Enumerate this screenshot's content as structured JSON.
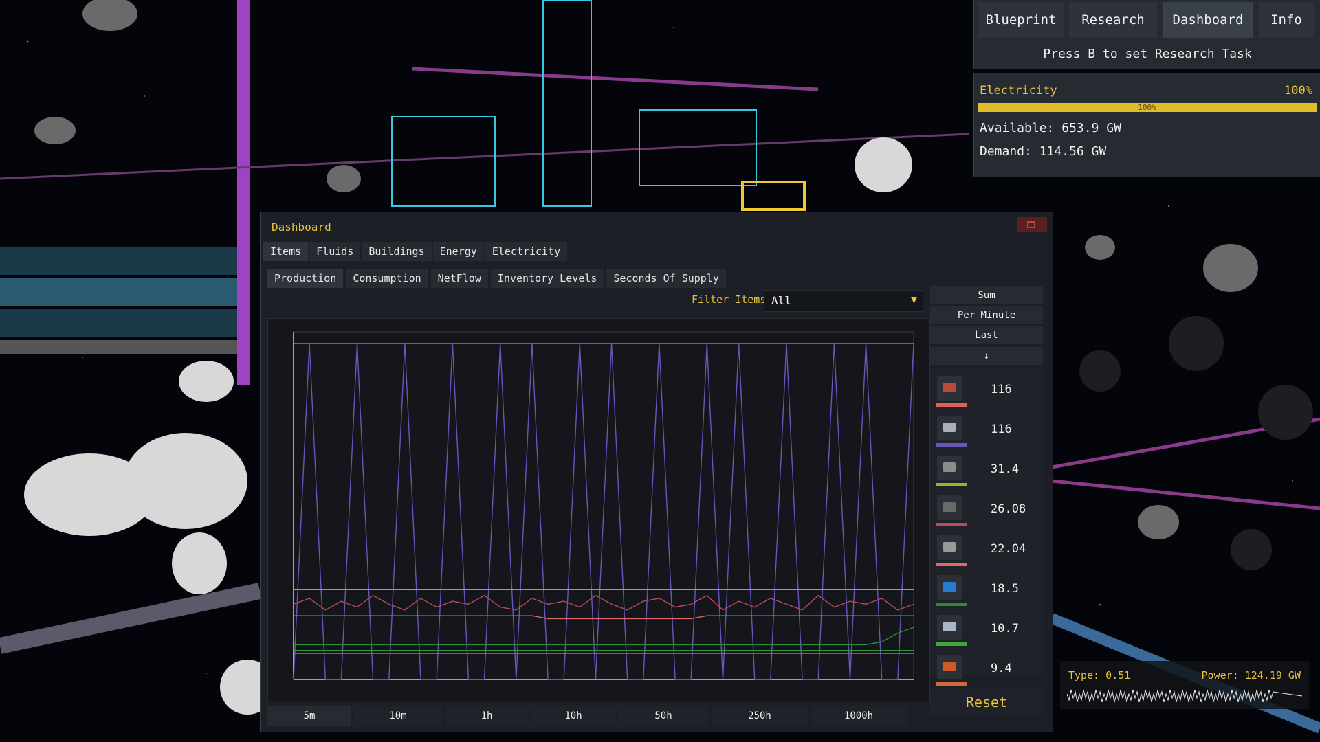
{
  "top_nav": {
    "tabs": [
      {
        "label": "Blueprint"
      },
      {
        "label": "Research"
      },
      {
        "label": "Dashboard",
        "active": true
      },
      {
        "label": "Info"
      }
    ],
    "hint": "Press B to set Research Task"
  },
  "electricity": {
    "title": "Electricity",
    "percent": "100%",
    "bar_fraction": 1.0,
    "bar_text": "100%",
    "available": "Available: 653.9 GW",
    "demand": "Demand: 114.56 GW"
  },
  "dashboard": {
    "title": "Dashboard",
    "main_tabs": [
      {
        "label": "Items",
        "active": true
      },
      {
        "label": "Fluids"
      },
      {
        "label": "Buildings"
      },
      {
        "label": "Energy"
      },
      {
        "label": "Electricity"
      }
    ],
    "sub_tabs": [
      {
        "label": "Production",
        "active": true
      },
      {
        "label": "Consumption"
      },
      {
        "label": "NetFlow"
      },
      {
        "label": "Inventory Levels"
      },
      {
        "label": "Seconds Of Supply"
      }
    ],
    "filter": {
      "label": "Filter Items",
      "value": "All"
    },
    "side_buttons": {
      "sum": "Sum",
      "per_minute": "Per Minute",
      "last": "Last",
      "sort": "↓"
    },
    "legend": [
      {
        "icon": "red-ore-icon",
        "color": "#e0605a",
        "icon_color": "#b84a3a",
        "value": "116"
      },
      {
        "icon": "silver-ore-icon",
        "color": "#6a55b8",
        "icon_color": "#aab0bc",
        "value": "116"
      },
      {
        "icon": "plate-icon",
        "color": "#8fb82a",
        "icon_color": "#8c8c8c",
        "value": "31.4"
      },
      {
        "icon": "dark-ore-icon",
        "color": "#b84a5c",
        "icon_color": "#6a6a6a",
        "value": "26.08"
      },
      {
        "icon": "machine-part-icon",
        "color": "#e06a6a",
        "icon_color": "#9a9a9a",
        "value": "22.04"
      },
      {
        "icon": "blue-sphere-icon",
        "color": "#2e8a3a",
        "icon_color": "#2a7ad0",
        "value": "18.5"
      },
      {
        "icon": "steel-bar-icon",
        "color": "#3aa83a",
        "icon_color": "#a8b8c8",
        "value": "10.7"
      },
      {
        "icon": "copper-block-icon",
        "color": "#d06a3a",
        "icon_color": "#d0582a",
        "value": "9.4"
      }
    ],
    "reset": "Reset",
    "time_ranges": [
      {
        "label": "5m",
        "active": true
      },
      {
        "label": "10m"
      },
      {
        "label": "1h"
      },
      {
        "label": "10h"
      },
      {
        "label": "50h"
      },
      {
        "label": "250h"
      },
      {
        "label": "1000h"
      }
    ]
  },
  "power_monitor": {
    "type": "Type: 0.51",
    "power": "Power: 124.19 GW"
  },
  "chart_data": {
    "type": "line",
    "title": "",
    "xlabel": "",
    "ylabel": "",
    "grid": false,
    "series": [
      {
        "color": "#e0605a",
        "values": [
          116,
          116,
          116,
          116,
          116,
          116,
          116,
          116,
          116,
          116,
          116,
          116,
          116,
          116,
          116,
          116,
          116,
          116,
          116,
          116,
          116,
          116,
          116,
          116,
          116,
          116,
          116,
          116,
          116,
          116,
          116,
          116,
          116,
          116,
          116,
          116,
          116,
          116,
          116,
          116
        ]
      },
      {
        "color": "#6a55b8",
        "values": [
          0,
          116,
          0,
          0,
          116,
          0,
          0,
          116,
          0,
          0,
          116,
          0,
          0,
          116,
          0,
          116,
          0,
          0,
          116,
          0,
          116,
          0,
          0,
          116,
          0,
          0,
          116,
          0,
          116,
          0,
          0,
          116,
          0,
          0,
          116,
          0,
          116,
          0,
          0,
          116
        ]
      },
      {
        "color": "#8fb82a",
        "values": [
          31,
          31,
          31,
          31,
          31,
          31,
          31,
          31,
          31,
          31,
          31,
          31,
          31,
          31,
          31,
          31,
          31,
          31,
          31,
          31,
          31,
          31,
          31,
          31,
          31,
          31,
          31,
          31,
          31,
          31,
          31,
          31,
          31,
          31,
          31,
          31,
          31,
          31,
          31,
          31
        ]
      },
      {
        "color": "#b84a5c",
        "values": [
          26,
          28,
          24,
          27,
          25,
          29,
          26,
          24,
          28,
          25,
          27,
          26,
          29,
          25,
          24,
          28,
          26,
          27,
          25,
          29,
          26,
          24,
          27,
          28,
          25,
          26,
          29,
          24,
          27,
          25,
          28,
          26,
          24,
          29,
          25,
          27,
          26,
          28,
          24,
          26
        ]
      },
      {
        "color": "#e06a6a",
        "values": [
          22,
          22,
          22,
          22,
          22,
          22,
          22,
          22,
          22,
          22,
          22,
          22,
          22,
          22,
          22,
          22,
          21,
          21,
          21,
          21,
          21,
          21,
          21,
          21,
          21,
          21,
          22,
          22,
          22,
          22,
          22,
          22,
          22,
          22,
          22,
          22,
          22,
          22,
          22,
          22
        ]
      },
      {
        "color": "#2e8a3a",
        "values": [
          12,
          12,
          12,
          12,
          12,
          12,
          12,
          12,
          12,
          12,
          12,
          12,
          12,
          12,
          12,
          12,
          12,
          12,
          12,
          12,
          12,
          12,
          12,
          12,
          12,
          12,
          12,
          12,
          12,
          12,
          12,
          12,
          12,
          12,
          12,
          12,
          12,
          13,
          16,
          18
        ]
      },
      {
        "color": "#3aa83a",
        "values": [
          10,
          10,
          10,
          10,
          10,
          10,
          10,
          10,
          10,
          10,
          10,
          10,
          10,
          10,
          10,
          10,
          10,
          10,
          10,
          10,
          10,
          10,
          10,
          10,
          10,
          10,
          10,
          10,
          10,
          10,
          10,
          10,
          10,
          10,
          10,
          10,
          10,
          10,
          10,
          10
        ]
      },
      {
        "color": "#d06a3a",
        "values": [
          9,
          9,
          9,
          9,
          9,
          9,
          9,
          9,
          9,
          9,
          9,
          9,
          9,
          9,
          9,
          9,
          9,
          9,
          9,
          9,
          9,
          9,
          9,
          9,
          9,
          9,
          9,
          9,
          9,
          9,
          9,
          9,
          9,
          9,
          9,
          9,
          9,
          9,
          9,
          9
        ]
      }
    ]
  }
}
